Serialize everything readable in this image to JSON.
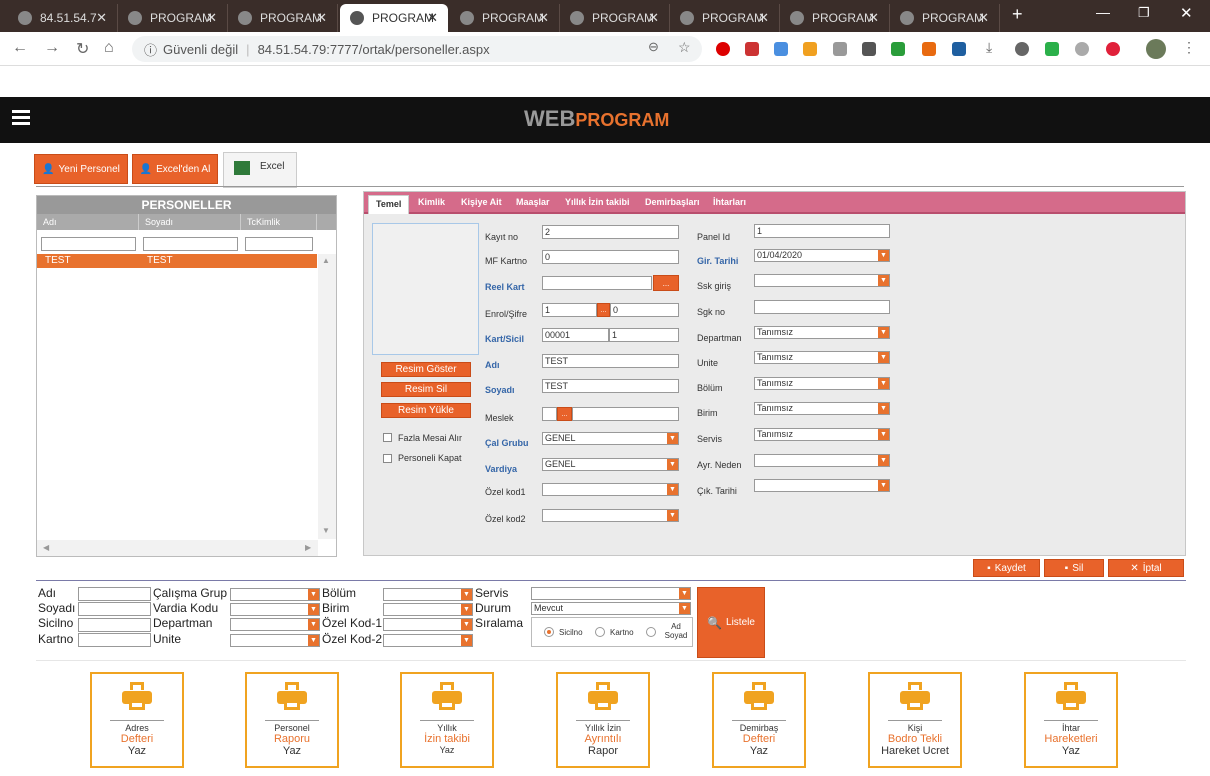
{
  "browser": {
    "tabs": [
      "84.51.54.7",
      "PROGRAM",
      "PROGRAM",
      "PROGRAM",
      "PROGRAM",
      "PROGRAM",
      "PROGRAM",
      "PROGRAM",
      "PROGRAM"
    ],
    "security_label": "Güvenli değil",
    "url": "84.51.54.79:7777/ortak/personeller.aspx"
  },
  "app": {
    "brand_web": "WEB",
    "brand_program": "PROGRAM"
  },
  "toolbar": {
    "new_personnel": "Yeni Personel",
    "from_excel": "Excel'den Al",
    "excel": "Excel"
  },
  "list": {
    "title": "PERSONELLER",
    "columns": [
      "Adı",
      "Soyadı",
      "TcKimlik"
    ],
    "rows": [
      {
        "adi": "TEST",
        "soyadi": "TEST",
        "tc": ""
      }
    ]
  },
  "form": {
    "tabs": [
      "Temel",
      "Kimlik",
      "Kişiye Ait",
      "Maaşlar",
      "Yıllık İzin takibi",
      "Demirbaşları",
      "İhtarları"
    ],
    "photo_buttons": {
      "show": "Resim Göster",
      "delete": "Resim Sil",
      "upload": "Resim Yükle"
    },
    "checks": {
      "overtime": "Fazla Mesai Alır",
      "close": "Personeli Kapat"
    },
    "labels": {
      "kayit_no": "Kayıt no",
      "mf_kartno": "MF Kartno",
      "reel_kart": "Reel Kart",
      "enrol": "Enrol/Şifre",
      "kart_sicil": "Kart/Sicil",
      "adi": "Adı",
      "soyadi": "Soyadı",
      "meslek": "Meslek",
      "cal_grubu": "Çal Grubu",
      "vardiya": "Vardiya",
      "ozel_kod1": "Özel kod1",
      "ozel_kod2": "Özel kod2",
      "panel_id": "Panel Id",
      "gir_tarihi": "Gir. Tarihi",
      "ssk_giris": "Ssk giriş",
      "sgk_no": "Sgk no",
      "departman": "Departman",
      "unite": "Unite",
      "bolum": "Bölüm",
      "birim": "Birim",
      "servis": "Servis",
      "ayr_neden": "Ayr. Neden",
      "cik_tarihi": "Çık. Tarihi"
    },
    "values": {
      "kayit_no": "2",
      "mf_kartno": "0",
      "reel_kart": "",
      "enrol_a": "1",
      "enrol_b": "0",
      "kart": "00001",
      "sicil": "1",
      "adi": "TEST",
      "soyadi": "TEST",
      "meslek": "",
      "cal_grubu": "GENEL",
      "vardiya": "GENEL",
      "ozel_kod1": "",
      "ozel_kod2": "",
      "panel_id": "1",
      "gir_tarihi": "01/04/2020",
      "ssk_giris": "",
      "sgk_no": "",
      "departman": "Tanımsız",
      "unite": "Tanımsız",
      "bolum": "Tanımsız",
      "birim": "Tanımsız",
      "servis": "Tanımsız",
      "ayr_neden": "",
      "cik_tarihi": ""
    },
    "dots": "...",
    "actions": {
      "save": "Kaydet",
      "delete": "Sil",
      "cancel": "İptal"
    }
  },
  "filters": {
    "labels": {
      "adi": "Adı",
      "soyadi": "Soyadı",
      "sicilno": "Sicilno",
      "kartno": "Kartno",
      "calisma_grup": "Çalışma Grup",
      "vardia_kodu": "Vardia Kodu",
      "departman": "Departman",
      "unite": "Unite",
      "bolum": "Bölüm",
      "birim": "Birim",
      "ozel_kod1": "Özel Kod-1",
      "ozel_kod2": "Özel Kod-2",
      "servis": "Servis",
      "durum": "Durum",
      "siralama": "Sıralama"
    },
    "durum_value": "Mevcut",
    "sort_options": [
      "Sicilno",
      "Kartno",
      "Ad Soyad"
    ],
    "list_button": "Listele"
  },
  "reports": [
    {
      "l1": "Adres",
      "l2": "Defteri",
      "l3": "Yaz"
    },
    {
      "l1": "Personel",
      "l2": "Raporu",
      "l3": "Yaz"
    },
    {
      "l1": "Yıllık",
      "l2": "İzin takibi",
      "l3": "Yaz"
    },
    {
      "l1": "Yıllık İzin",
      "l2": "Ayrıntılı",
      "l3": "Rapor"
    },
    {
      "l1": "Demirbaş",
      "l2": "Defteri",
      "l3": "Yaz"
    },
    {
      "l1": "Kişi",
      "l2": "Bodro Tekli",
      "l3": "Hareket Ucret"
    },
    {
      "l1": "İhtar",
      "l2": "Hareketleri",
      "l3": "Yaz"
    }
  ]
}
